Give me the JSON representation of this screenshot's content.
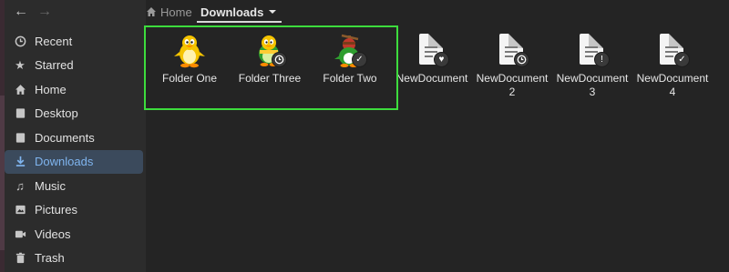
{
  "nav": {
    "back_icon": "arrow-left-icon",
    "forward_icon": "arrow-right-icon"
  },
  "path": {
    "home_label": "Home",
    "current_label": "Downloads",
    "home_icon": "home-icon",
    "dropdown_icon": "chevron-down-icon"
  },
  "sidebar": {
    "items": [
      {
        "label": "Recent",
        "icon": "clock-icon"
      },
      {
        "label": "Starred",
        "icon": "star-icon"
      },
      {
        "label": "Home",
        "icon": "home-icon"
      },
      {
        "label": "Desktop",
        "icon": "folder-icon"
      },
      {
        "label": "Documents",
        "icon": "folder-icon"
      },
      {
        "label": "Downloads",
        "icon": "download-icon",
        "active": true
      },
      {
        "label": "Music",
        "icon": "music-icon"
      },
      {
        "label": "Pictures",
        "icon": "pictures-icon"
      },
      {
        "label": "Videos",
        "icon": "video-icon"
      },
      {
        "label": "Trash",
        "icon": "trash-icon"
      }
    ]
  },
  "files": [
    {
      "label": "Folder One",
      "icon": "yellow-penguin-folder-icon"
    },
    {
      "label": "Folder Three",
      "icon": "green-penguin-folder-icon"
    },
    {
      "label": "Folder Two",
      "icon": "propeller-penguin-folder-icon"
    },
    {
      "label": "NewDocument",
      "icon": "document-icon",
      "emblem": "heart-emblem-icon"
    },
    {
      "label": "NewDocument 2",
      "icon": "document-icon",
      "emblem": "clock-emblem-icon"
    },
    {
      "label": "NewDocument 3",
      "icon": "document-icon",
      "emblem": "important-emblem-icon"
    },
    {
      "label": "NewDocument 4",
      "icon": "document-icon",
      "emblem": "check-emblem-icon"
    }
  ],
  "colors": {
    "selection": "#3ddc3d",
    "active_item": "#7fb4ee",
    "background": "#242424"
  }
}
